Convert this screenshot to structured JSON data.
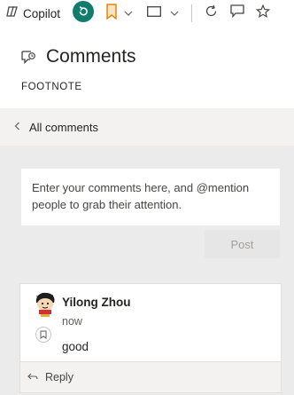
{
  "toolbar": {
    "copilot_label": "Copilot"
  },
  "header": {
    "title": "Comments",
    "subtitle": "FOOTNOTE"
  },
  "nav": {
    "back_label": "All comments"
  },
  "composer": {
    "placeholder": "Enter your comments here, and @mention people to grab their attention.",
    "post_label": "Post"
  },
  "comments": [
    {
      "author": "Yilong Zhou",
      "time": "now",
      "text": "good",
      "reply_label": "Reply"
    }
  ],
  "colors": {
    "accent_green": "#107c6b",
    "bookmark_orange": "#e8850b",
    "pane_background": "#ebebeb"
  },
  "icons": [
    "copilot-icon",
    "refresh-icon",
    "bookmark-icon",
    "chevron-down-icon",
    "rectangle-icon",
    "reload-icon",
    "comment-icon",
    "star-icon",
    "comment-bubble-icon",
    "chevron-left-icon",
    "bookmark-small-icon",
    "reply-icon"
  ]
}
